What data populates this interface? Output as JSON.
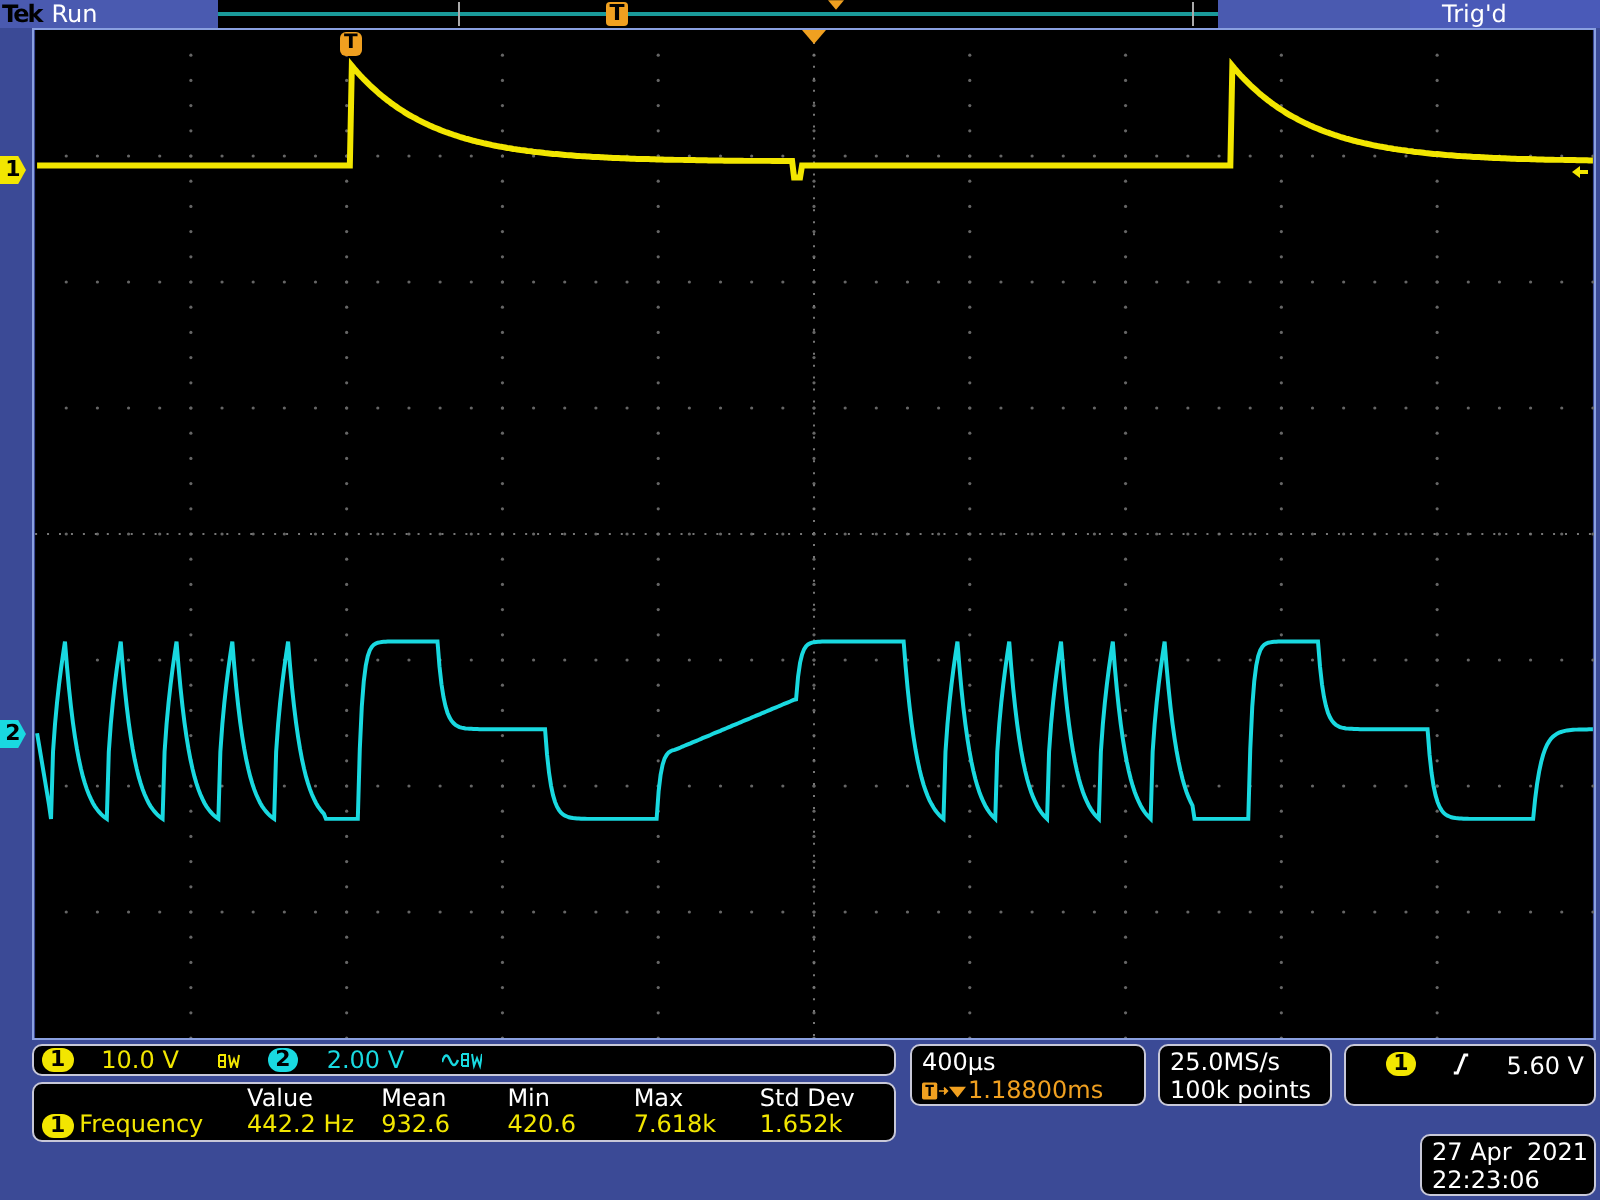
{
  "status_bar": {
    "brand": "Tek",
    "state": "Run",
    "record_marker": "T",
    "trigger_status": "Trig'd"
  },
  "plot": {
    "trigger_marker": "T"
  },
  "channels": [
    {
      "marker": "1",
      "number": "1",
      "scale": "10.0 V",
      "color": "#f2e600"
    },
    {
      "marker": "2",
      "number": "2",
      "scale": "2.00 V",
      "color": "#19d9e0"
    }
  ],
  "measurements": {
    "columns": [
      "Value",
      "Mean",
      "Min",
      "Max",
      "Std Dev"
    ],
    "rows": [
      {
        "channel": "1",
        "name": "Frequency",
        "cells": [
          "442.2 Hz",
          "932.6",
          "420.6",
          "7.618k",
          "1.652k"
        ]
      }
    ]
  },
  "horizontal": {
    "scale": "400µs",
    "position": "1.18800ms"
  },
  "acquisition": {
    "sample_rate": "25.0MS/s",
    "record_length": "100k points"
  },
  "trigger": {
    "channel": "1",
    "level": "5.60 V"
  },
  "datetime": {
    "date": "27 Apr  2021",
    "time": "22:23:06"
  }
}
